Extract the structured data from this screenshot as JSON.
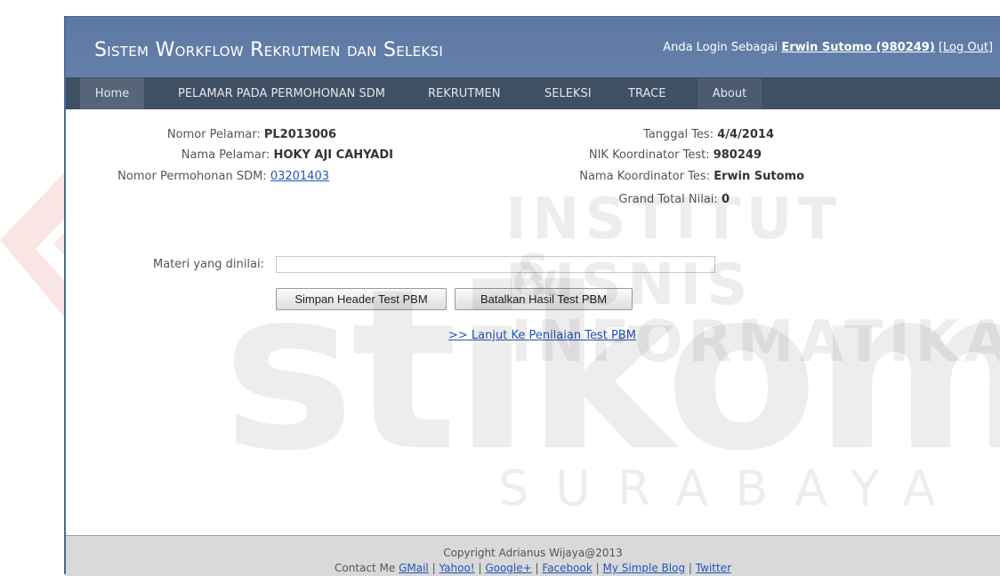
{
  "header": {
    "site_title": "Sistem Workflow Rekrutmen dan Seleksi",
    "login_prefix": "Anda Login Sebagai",
    "login_user": "Erwin Sutomo (980249)",
    "logout_open": "[",
    "logout_label": "Log Out",
    "logout_close": "]"
  },
  "nav": {
    "items": [
      {
        "label": "Home"
      },
      {
        "label": "PELAMAR PADA PERMOHONAN SDM"
      },
      {
        "label": "REKRUTMEN"
      },
      {
        "label": "SELEKSI"
      },
      {
        "label": "TRACE"
      },
      {
        "label": "About"
      }
    ]
  },
  "applicant": {
    "nomor_pelamar_label": "Nomor Pelamar:",
    "nomor_pelamar": "PL2013006",
    "nama_pelamar_label": "Nama Pelamar:",
    "nama_pelamar": "HOKY AJI CAHYADI",
    "nomor_permohonan_label": "Nomor Permohonan SDM:",
    "nomor_permohonan": "03201403"
  },
  "test": {
    "tanggal_label": "Tanggal Tes:",
    "tanggal": "4/4/2014",
    "nik_label": "NIK Koordinator Test:",
    "nik": "980249",
    "nama_koordinator_label": "Nama Koordinator Tes:",
    "nama_koordinator": "Erwin Sutomo",
    "grand_total_label": "Grand Total Nilai:",
    "grand_total": "0"
  },
  "form": {
    "materi_label": "Materi yang dinilai:",
    "materi_value": "",
    "save_button": "Simpan Header Test PBM",
    "cancel_button": "Batalkan Hasil Test PBM",
    "continue_link": ">> Lanjut Ke Penilaian Test PBM"
  },
  "footer": {
    "copyright": "Copyright Adrianus Wijaya@2013",
    "contact_prefix": "Contact Me",
    "links": [
      "GMail",
      "Yahoo!",
      "Google+",
      "Facebook",
      "My Simple Blog",
      "Twitter"
    ],
    "separator": "|"
  },
  "watermark": {
    "line1": "INSTITUT BISNIS",
    "line2": "& INFORMATIKA",
    "brand": "stikom",
    "city": "SURABAYA"
  },
  "colors": {
    "header_bg": "#6480aa",
    "nav_bg": "#3f4f64",
    "link": "#2255bb"
  }
}
